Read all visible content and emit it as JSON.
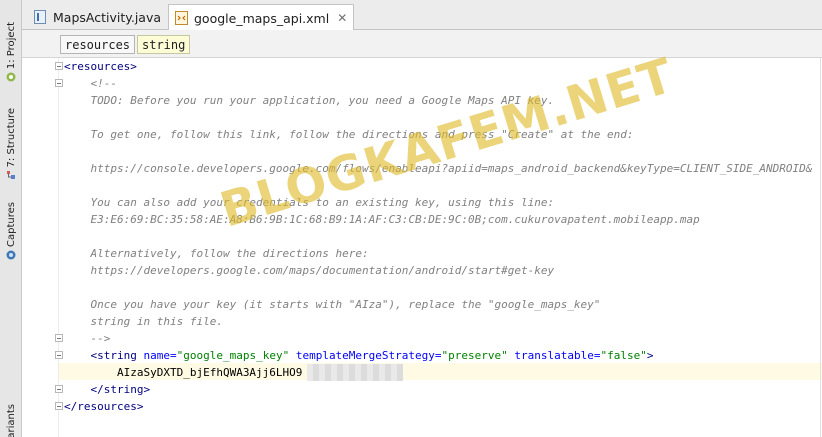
{
  "tool_windows": {
    "project": "1: Project",
    "structure": "7: Structure",
    "captures": "Captures",
    "variants": "Variants"
  },
  "tabs": [
    {
      "label": "MapsActivity.java",
      "icon": "java-file-icon",
      "active": false
    },
    {
      "label": "google_maps_api.xml",
      "icon": "xml-file-icon",
      "active": true
    }
  ],
  "breadcrumb": [
    "resources",
    "string"
  ],
  "code": {
    "lines": [
      "<resources>",
      "    <!--",
      "    TODO: Before you run your application, you need a Google Maps API key.",
      "",
      "    To get one, follow this link, follow the directions and press \"Create\" at the end:",
      "",
      "    https://console.developers.google.com/flows/enableapi?apiid=maps_android_backend&keyType=CLIENT_SIDE_ANDROID&",
      "",
      "    You can also add your credentials to an existing key, using this line:",
      "    E3:E6:69:BC:35:58:AE:A8:B6:9B:1C:68:B9:1A:AF:C3:CB:DE:9C:0B;com.cukurovapatent.mobileapp.map",
      "",
      "    Alternatively, follow the directions here:",
      "    https://developers.google.com/maps/documentation/android/start#get-key",
      "",
      "    Once you have your key (it starts with \"AIza\"), replace the \"google_maps_key\"",
      "    string in this file.",
      "    -->",
      "    <string name=\"google_maps_key\" templateMergeStrategy=\"preserve\" translatable=\"false\">",
      "        AIzaSyDXTD_bjEfhQWA3Ajj6LHO9",
      "    </string>",
      "</resources>"
    ],
    "string_tag": {
      "open": "<string ",
      "attr1_name": "name=",
      "attr1_value": "\"google_maps_key\"",
      "attr2_name": " templateMergeStrategy=",
      "attr2_value": "\"preserve\"",
      "attr3_name": " translatable=",
      "attr3_value": "\"false\"",
      "close": ">"
    },
    "key_text": "AIzaSyDXTD_bjEfhQWA3Ajj6LHO9"
  },
  "watermark": "BLOGKAFEM.NET",
  "colors": {
    "comment": "#808080",
    "tag": "#000080",
    "attr_name": "#0000ff",
    "attr_value": "#008000",
    "current_line": "#fffae3",
    "watermark": "#deba28"
  }
}
